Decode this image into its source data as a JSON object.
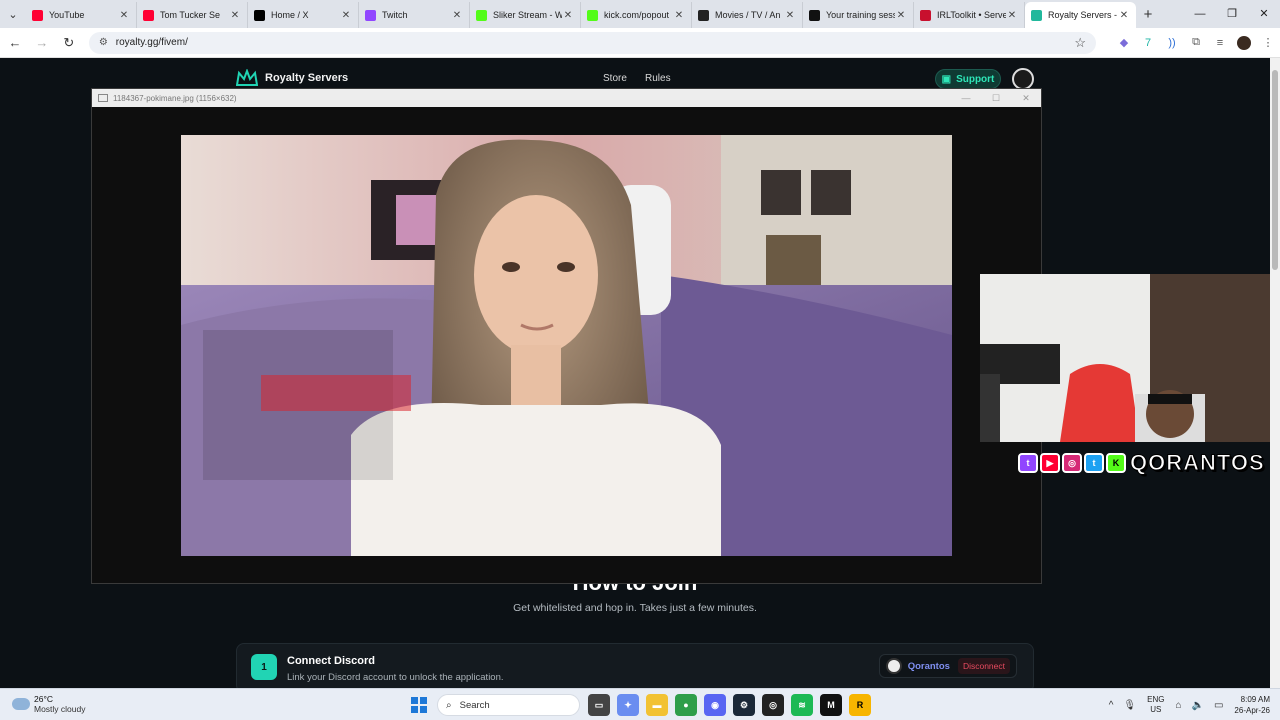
{
  "browser": {
    "tabs": [
      {
        "title": "YouTube",
        "color": "#ff0033"
      },
      {
        "title": "Tom Tucker Se",
        "color": "#ff0033"
      },
      {
        "title": "Home / X",
        "color": "#000000"
      },
      {
        "title": "Twitch",
        "color": "#9146ff"
      },
      {
        "title": "Sliker Stream - W",
        "color": "#53fc18"
      },
      {
        "title": "kick.com/popout",
        "color": "#53fc18"
      },
      {
        "title": "Movies / TV / An",
        "color": "#222222"
      },
      {
        "title": "Your training sess",
        "color": "#111111"
      },
      {
        "title": "IRLToolkit • Server",
        "color": "#c8102e"
      },
      {
        "title": "Royalty Servers -",
        "color": "#21b89c"
      }
    ],
    "url": "royalty.gg/fivem/"
  },
  "site": {
    "brand": "Royalty Servers",
    "nav_store": "Store",
    "nav_rules": "Rules",
    "support_label": "Support",
    "accent": "#21d4b4",
    "howto_title": "How to Join",
    "howto_subtitle": "Get whitelisted and hop in. Takes just a few minutes.",
    "step": {
      "number": "1",
      "title": "Connect Discord",
      "description": "Link your Discord account to unlock the application.",
      "username": "Qorantos",
      "disconnect_label": "Disconnect"
    }
  },
  "viewer": {
    "title": "1184367-pokimane.jpg (1156×632)"
  },
  "overlay": {
    "handle": "QORANTOS",
    "socials": [
      "twitch-icon",
      "youtube-icon",
      "instagram-icon",
      "twitter-icon",
      "kick-icon"
    ]
  },
  "taskbar": {
    "temperature": "26°C",
    "condition": "Mostly cloudy",
    "search_placeholder": "Search",
    "lang_top": "ENG",
    "lang_bottom": "US",
    "time": "8:09 AM",
    "date": "26-Apr-26"
  }
}
